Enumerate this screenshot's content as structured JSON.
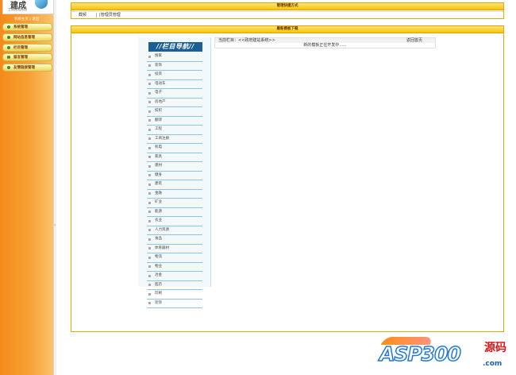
{
  "sidebar": {
    "logo_title": "建成",
    "logo_subtitle": "工商建站系统",
    "system_label": "系统主页",
    "separator": "|",
    "logout_label": "退出",
    "menu": [
      {
        "label": "系统管理"
      },
      {
        "label": "网站信息管理"
      },
      {
        "label": "栏目管理"
      },
      {
        "label": "留言管理"
      },
      {
        "label": "友情链接管理"
      }
    ]
  },
  "quick_panel": {
    "title": "管理快捷方式",
    "name": "截频",
    "separator": "|",
    "link": "管理员管理"
  },
  "download_panel": {
    "title": "最新模板下载",
    "nav_header": "//栏目导航//",
    "nav_items": [
      "搜家",
      "装饰",
      "投资",
      "电动车",
      "电子",
      "房地产",
      "纺织",
      "翻译",
      "工程",
      "工商注册",
      "机电",
      "家具",
      "建材",
      "健身",
      "建筑",
      "金融",
      "矿业",
      "能源",
      "农业",
      "人力资源",
      "食品",
      "体育器材",
      "物流",
      "物业",
      "冶金",
      "医药",
      "印刷",
      "装饰"
    ],
    "current_label": "当前栏目：<<政府建站系统>>",
    "home_link": "返回首页",
    "message": "新的模板正在开发中......"
  },
  "watermark": {
    "text": "ASP300",
    "cn": "源码",
    "domain": ".com"
  }
}
